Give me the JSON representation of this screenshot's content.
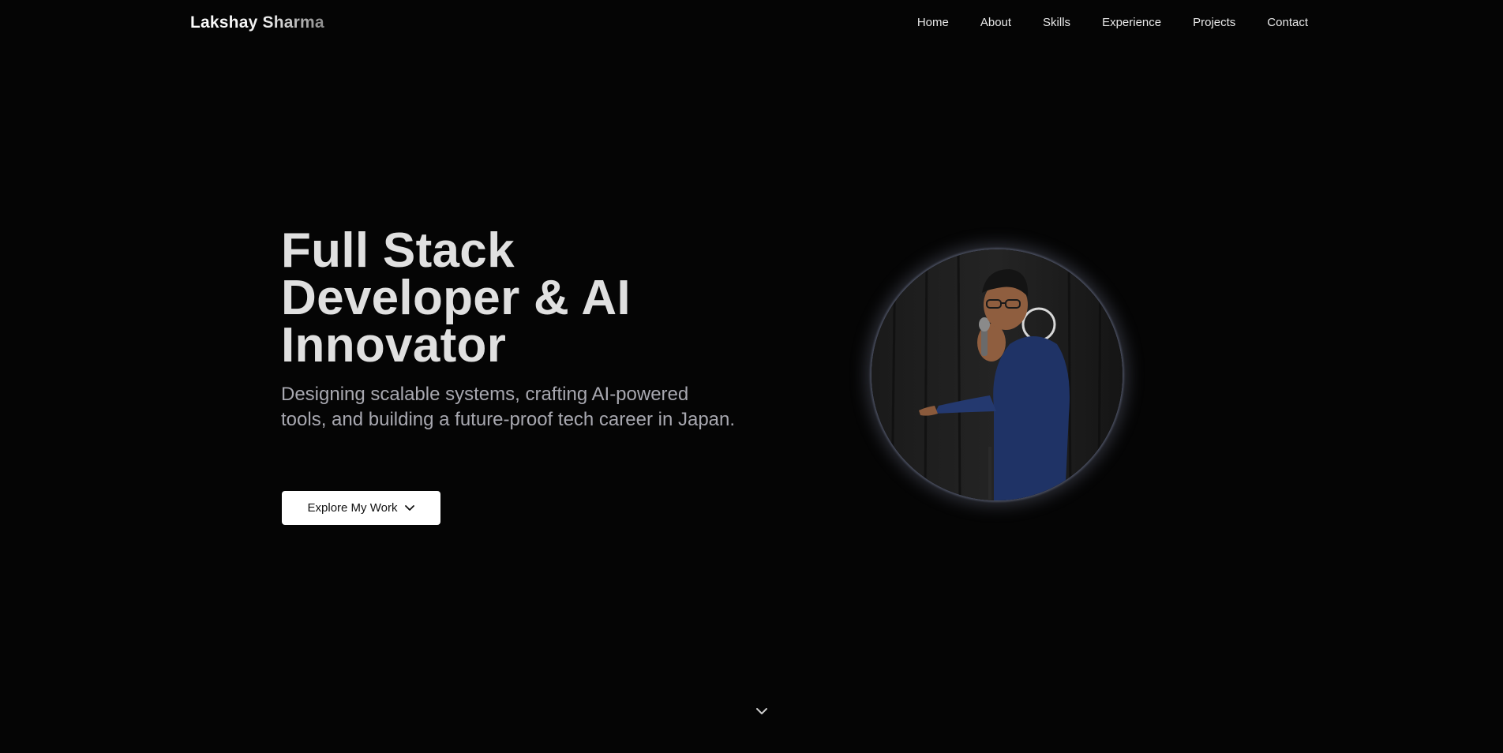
{
  "header": {
    "brand": "Lakshay Sharma",
    "nav": [
      "Home",
      "About",
      "Skills",
      "Experience",
      "Projects",
      "Contact"
    ]
  },
  "hero": {
    "headline_lines": [
      "Full Stack",
      "Developer & AI",
      "Innovator"
    ],
    "subtext": "Designing scalable systems, crafting AI-powered tools, and building a future-proof tech career in Japan.",
    "cta_label": "Explore My Work",
    "cta_icon": "chevron-down-icon",
    "portrait": "profile-photo"
  },
  "scroll_hint_icon": "chevron-down-icon",
  "colors": {
    "background": "#050505",
    "headline": "#e0e0e0",
    "subtext": "#a8a8b0",
    "cta_bg": "#ffffff",
    "cta_text": "#111111",
    "portrait_glow": "#a0aac8"
  }
}
